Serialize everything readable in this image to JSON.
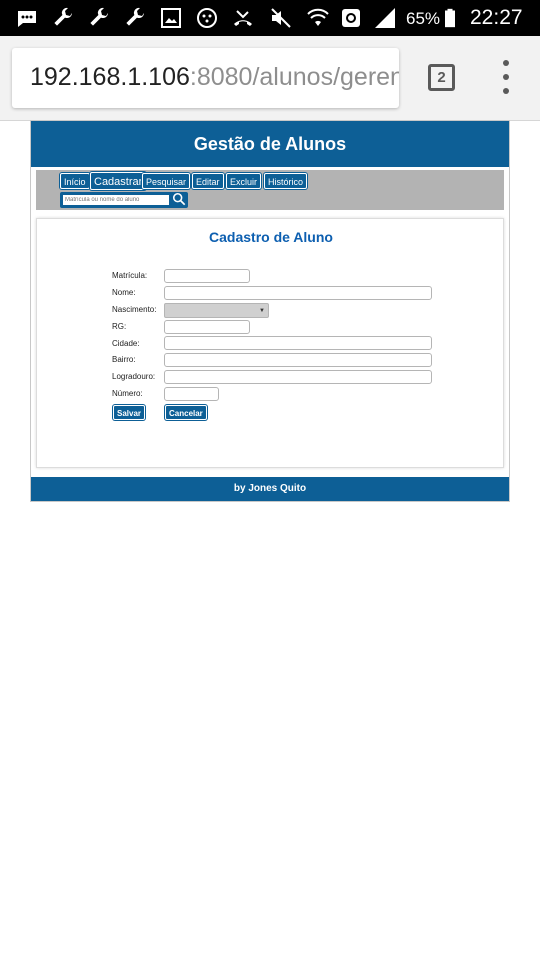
{
  "status_bar": {
    "battery": "65%",
    "time": "22:27",
    "icons": [
      "chat-icon",
      "wrench-icon",
      "wrench-icon",
      "wrench-icon",
      "image-icon",
      "face-icon",
      "missed-call-icon",
      "mute-icon",
      "wifi-icon",
      "nfc-icon",
      "signal-icon",
      "battery-icon"
    ]
  },
  "browser": {
    "url_host": "192.168.1.106",
    "url_path": ":8080/alunos/geren",
    "tab_count": "2"
  },
  "page": {
    "header_title": "Gestão de Alunos",
    "nav": {
      "items": [
        "Início",
        "Cadastrar",
        "Pesquisar",
        "Editar",
        "Excluir",
        "Histórico"
      ],
      "active": "Cadastrar"
    },
    "search": {
      "placeholder": "Matrícula ou nome do aluno"
    },
    "form": {
      "title": "Cadastro de Aluno",
      "labels": {
        "matricula": "Matrícula:",
        "nome": "Nome:",
        "nascimento": "Nascimento:",
        "rg": "RG:",
        "cidade": "Cidade:",
        "bairro": "Bairro:",
        "logradouro": "Logradouro:",
        "numero": "Número:"
      },
      "buttons": {
        "save": "Salvar",
        "cancel": "Cancelar"
      }
    },
    "footer": "by Jones Quito"
  },
  "colors": {
    "brand": "#0d5f96",
    "title": "#0d5fb0",
    "nav_bg": "#b3b3b3"
  }
}
